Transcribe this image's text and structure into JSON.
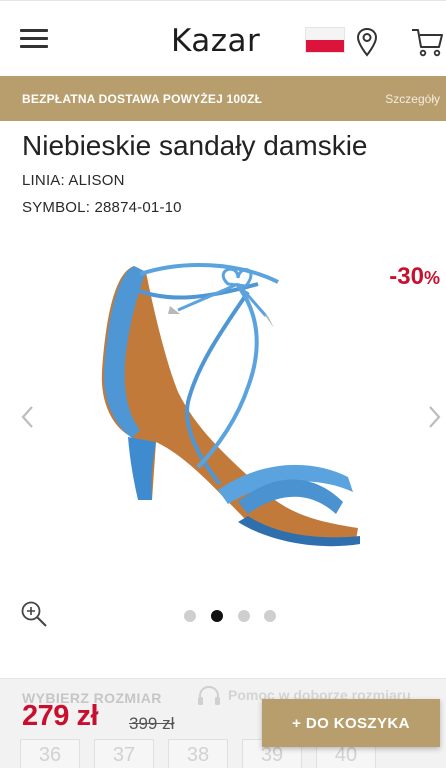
{
  "header": {
    "logo": "Kazar",
    "icons": [
      "menu-icon",
      "poland-flag-icon",
      "location-pin-icon",
      "cart-icon"
    ]
  },
  "promo": {
    "text": "BEZPŁATNA DOSTAWA POWYŻEJ 100ZŁ",
    "link": "Szczegóły"
  },
  "product": {
    "title": "Niebieskie sandały damskie",
    "line": "LINIA: ALISON",
    "symbol": "SYMBOL: 28874-01-10",
    "discount_value": "-30",
    "discount_unit": "%"
  },
  "gallery": {
    "dot_count": 4,
    "active_dot": 2
  },
  "sizes": {
    "label": "WYBIERZ ROZMIAR",
    "help": "Pomoc w doborze rozmiaru",
    "options": [
      "36",
      "37",
      "38",
      "39",
      "40"
    ]
  },
  "purchase": {
    "price": "279 zł",
    "old_price": "399 zł",
    "add_to_cart": "+ DO KOSZYKA"
  },
  "colors": {
    "accent": "#b89e6d",
    "price_red": "#c8102e",
    "shoe_blue": "#4f97d4"
  }
}
